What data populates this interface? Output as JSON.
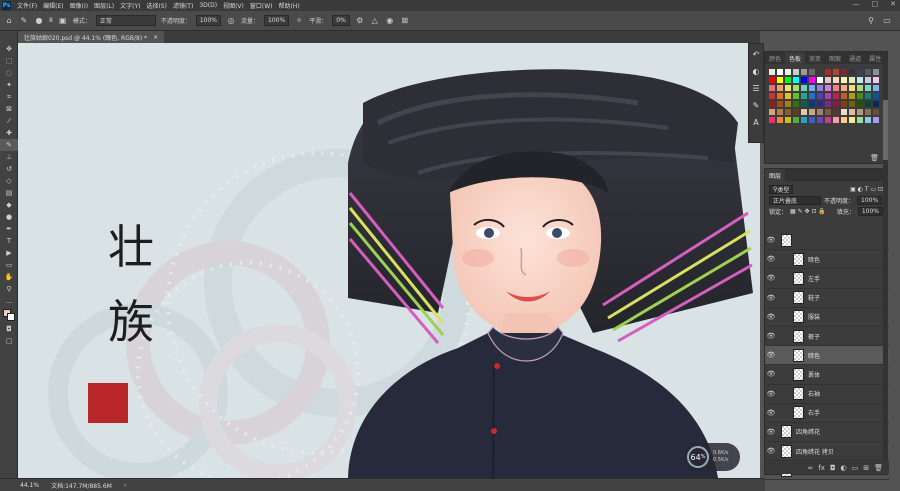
{
  "menubar": {
    "logo": "Ps",
    "items": [
      "文件(F)",
      "编辑(E)",
      "图像(I)",
      "图层(L)",
      "文字(Y)",
      "选择(S)",
      "滤镜(T)",
      "3D(D)",
      "视图(V)",
      "窗口(W)",
      "帮助(H)"
    ],
    "min": "—",
    "max": "□",
    "close": "✕"
  },
  "options": {
    "mode_label": "模式：",
    "mode_value": "正常",
    "opacity_label": "不透明度：",
    "opacity_value": "100%",
    "flow_label": "流量：",
    "flow_value": "100%",
    "smooth_label": "平滑：",
    "smooth_value": "0%",
    "brush_size": "8"
  },
  "document": {
    "tab_title": "壮族姑娘020.psd @ 44.1% (眼色, RGB/8) *",
    "close": "×"
  },
  "status": {
    "zoom": "44.1%",
    "doc_info": "文档:147.7M/885.6M",
    "arrow": "›"
  },
  "artwork": {
    "calligraphy_1": "壮",
    "calligraphy_2": "族",
    "seal": "刘渊艺印"
  },
  "swatches_panel": {
    "tabs": [
      "颜色",
      "色板",
      "渐变",
      "图案",
      "通道",
      "属性"
    ],
    "active_tab": "色板"
  },
  "layers_panel": {
    "title": "图层",
    "kind_label": "类型",
    "blend_mode": "正片叠底",
    "opacity_label": "不透明度：",
    "opacity_value": "100%",
    "lock_label": "锁定：",
    "fill_label": "填充：",
    "fill_value": "100%",
    "layers": [
      {
        "name": "",
        "selected": false
      },
      {
        "name": "暗色",
        "selected": false
      },
      {
        "name": "左手",
        "selected": false
      },
      {
        "name": "鞋子",
        "selected": false
      },
      {
        "name": "服装",
        "selected": false
      },
      {
        "name": "裤子",
        "selected": false
      },
      {
        "name": "暗色",
        "selected": true
      },
      {
        "name": "裹体",
        "selected": false
      },
      {
        "name": "右袖",
        "selected": false
      },
      {
        "name": "右手",
        "selected": false
      },
      {
        "name": "四角绣花",
        "selected": false
      },
      {
        "name": "四角绣花 拷贝",
        "selected": false
      },
      {
        "name": "中心绣花",
        "selected": false
      }
    ]
  },
  "zoom_widget": {
    "value": "64",
    "unit": "%",
    "stat1": "0.6K/s",
    "stat2": "0.5K/s"
  },
  "colors": {
    "turban": "#2b2b33",
    "pink_stripe": "#d45fbf",
    "yellow_stripe": "#d8e060",
    "green_stripe": "#9ed152",
    "canvas_bg": "#d9e3e6",
    "seal_red": "#b8262a"
  },
  "swatch_colors": [
    "#f7e7dc",
    "#ffffff",
    "#ededed",
    "#cacaca",
    "#9a9a9a",
    "#6a6a6a",
    "#3c3c3c",
    "#a22b2b",
    "#b8412d",
    "#7c2a3a",
    "#2f3440",
    "#3c4150",
    "#505a6a",
    "#8a8f98",
    "#ff0000",
    "#ffff00",
    "#00ff00",
    "#00ffff",
    "#0000ff",
    "#ff00ff",
    "#ffffff",
    "#f0c0c0",
    "#f8d8b8",
    "#fff0b8",
    "#d8f0c0",
    "#c0e8f0",
    "#c8c8f0",
    "#f0c8e8",
    "#e87070",
    "#f0a070",
    "#f0e070",
    "#a0e070",
    "#70d0c0",
    "#70b0f0",
    "#9080e0",
    "#d080d0",
    "#f08080",
    "#f0b080",
    "#e8e080",
    "#a8d880",
    "#78d8c8",
    "#80b0e8",
    "#d03030",
    "#e07020",
    "#e0c020",
    "#60c030",
    "#20a890",
    "#2070d0",
    "#5040c0",
    "#b040b0",
    "#c02050",
    "#c06020",
    "#b0a010",
    "#409020",
    "#108070",
    "#1050a0",
    "#902020",
    "#a05010",
    "#a08010",
    "#307018",
    "#086050",
    "#0a3880",
    "#302890",
    "#802880",
    "#901840",
    "#804010",
    "#706008",
    "#285010",
    "#064838",
    "#082860",
    "#d2a47c",
    "#b47c50",
    "#8c5a34",
    "#643c1e",
    "#e6c8a0",
    "#c8aa82",
    "#a08264",
    "#785a3c",
    "#503c28",
    "#f0dcc8",
    "#dcbca0",
    "#b49678",
    "#8c7050",
    "#645038",
    "#e6336a",
    "#f08a24",
    "#c8c020",
    "#4fb040",
    "#28a0c8",
    "#3a60c8",
    "#7040c0",
    "#c04090",
    "#ff99aa",
    "#ffcc88",
    "#eeee88",
    "#99dd99",
    "#88ccee",
    "#aa99ee"
  ]
}
